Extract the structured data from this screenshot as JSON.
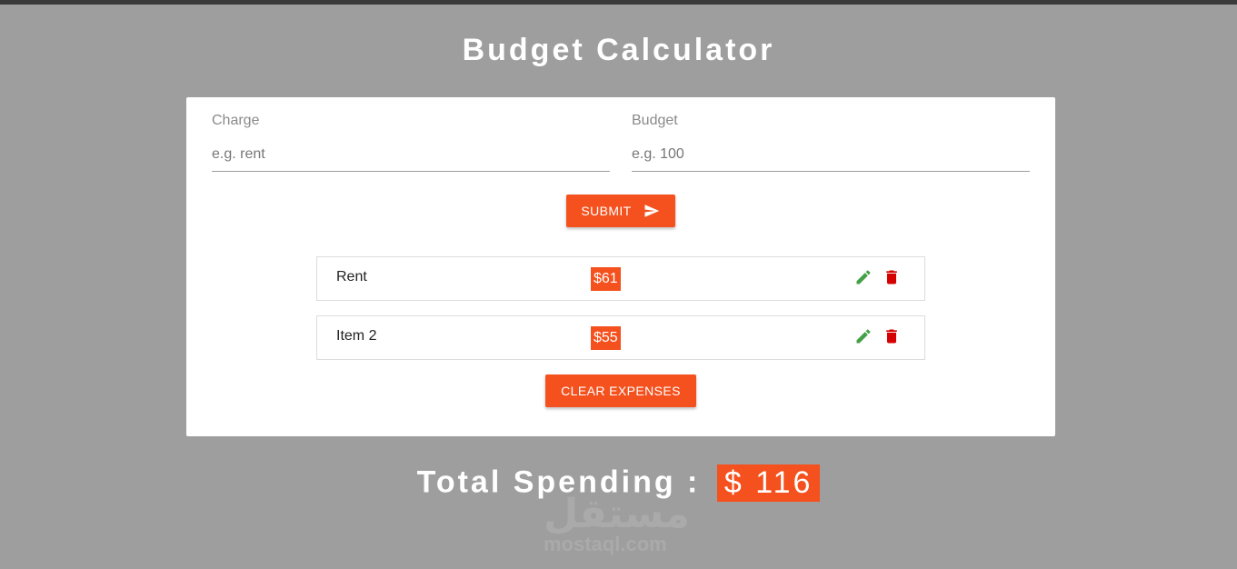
{
  "app": {
    "title": "Budget Calculator"
  },
  "form": {
    "charge": {
      "label": "Charge",
      "placeholder": "e.g. rent",
      "value": ""
    },
    "budget": {
      "label": "Budget",
      "placeholder": "e.g. 100",
      "value": ""
    },
    "submit_label": "SUBMIT"
  },
  "expenses": [
    {
      "name": "Rent",
      "amount": "$61"
    },
    {
      "name": "Item 2",
      "amount": "$55"
    }
  ],
  "clear_label": "CLEAR EXPENSES",
  "total": {
    "label": "Total Spending :",
    "value": "$ 116"
  },
  "watermark": {
    "arabic": "مستقل",
    "latin": "mostaql.com"
  },
  "icons": {
    "submit": "send-icon",
    "edit": "pencil-icon",
    "delete": "trash-icon"
  },
  "colors": {
    "accent": "#f4511e",
    "background": "#9e9e9e",
    "edit": "#43a047",
    "delete": "#d50000"
  }
}
